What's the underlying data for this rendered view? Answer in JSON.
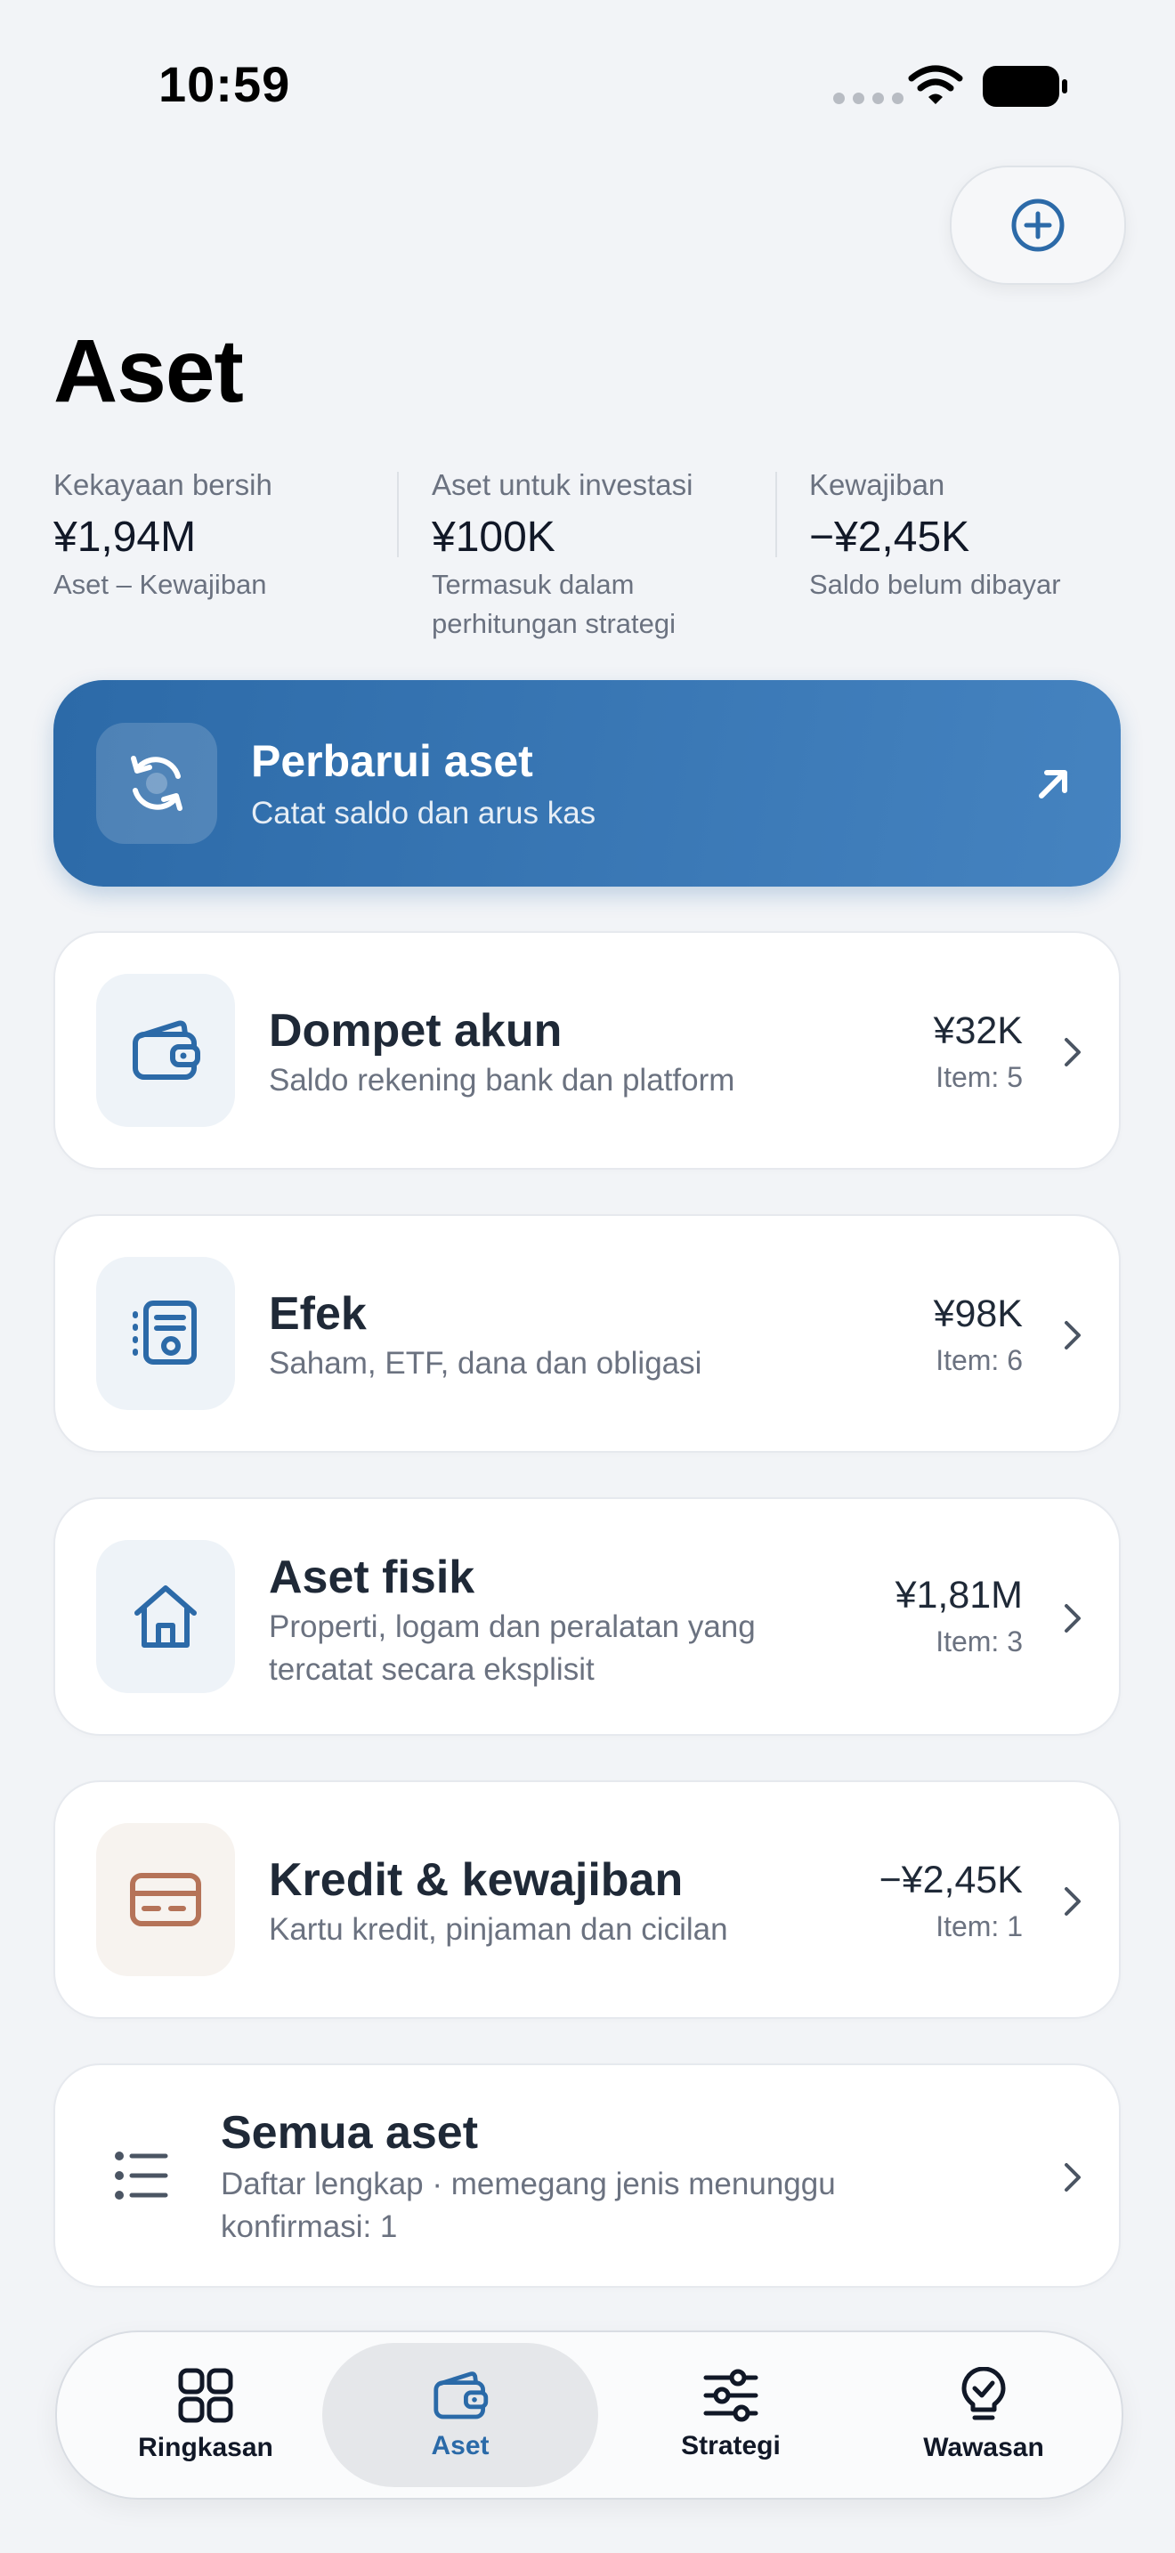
{
  "status_bar": {
    "time": "10:59"
  },
  "header": {
    "title": "Aset"
  },
  "summary": [
    {
      "label": "Kekayaan bersih",
      "value": "¥1,94M",
      "sub": "Aset – Kewajiban"
    },
    {
      "label": "Aset untuk investasi",
      "value": "¥100K",
      "sub": "Termasuk dalam perhitungan strategi"
    },
    {
      "label": "Kewajiban",
      "value": "−¥2,45K",
      "sub": "Saldo belum dibayar"
    }
  ],
  "update_card": {
    "title": "Perbarui aset",
    "subtitle": "Catat saldo dan arus kas",
    "icon": "refresh-icon"
  },
  "categories": [
    {
      "icon": "wallet-icon",
      "title": "Dompet akun",
      "subtitle": "Saldo rekening bank dan platform",
      "amount": "¥32K",
      "count": "Item: 5"
    },
    {
      "icon": "document-icon",
      "title": "Efek",
      "subtitle": "Saham, ETF, dana dan obligasi",
      "amount": "¥98K",
      "count": "Item: 6"
    },
    {
      "icon": "house-icon",
      "title": "Aset fisik",
      "subtitle": "Properti, logam dan peralatan yang tercatat secara eksplisit",
      "amount": "¥1,81M",
      "count": "Item: 3"
    },
    {
      "icon": "credit-card-icon",
      "title": "Kredit & kewajiban",
      "subtitle": "Kartu kredit, pinjaman dan cicilan",
      "amount": "−¥2,45K",
      "count": "Item: 1"
    }
  ],
  "all_assets": {
    "icon": "list-icon",
    "title": "Semua aset",
    "subtitle": "Daftar lengkap · memegang jenis menunggu konfirmasi: 1"
  },
  "tabbar": {
    "items": [
      {
        "label": "Ringkasan",
        "icon": "grid-icon"
      },
      {
        "label": "Aset",
        "icon": "wallet-icon",
        "active": true
      },
      {
        "label": "Strategi",
        "icon": "sliders-icon"
      },
      {
        "label": "Wawasan",
        "icon": "lightbulb-icon"
      }
    ]
  },
  "colors": {
    "accent": "#2c6aa8",
    "background": "#f2f4f7",
    "liability": "#b57358"
  }
}
